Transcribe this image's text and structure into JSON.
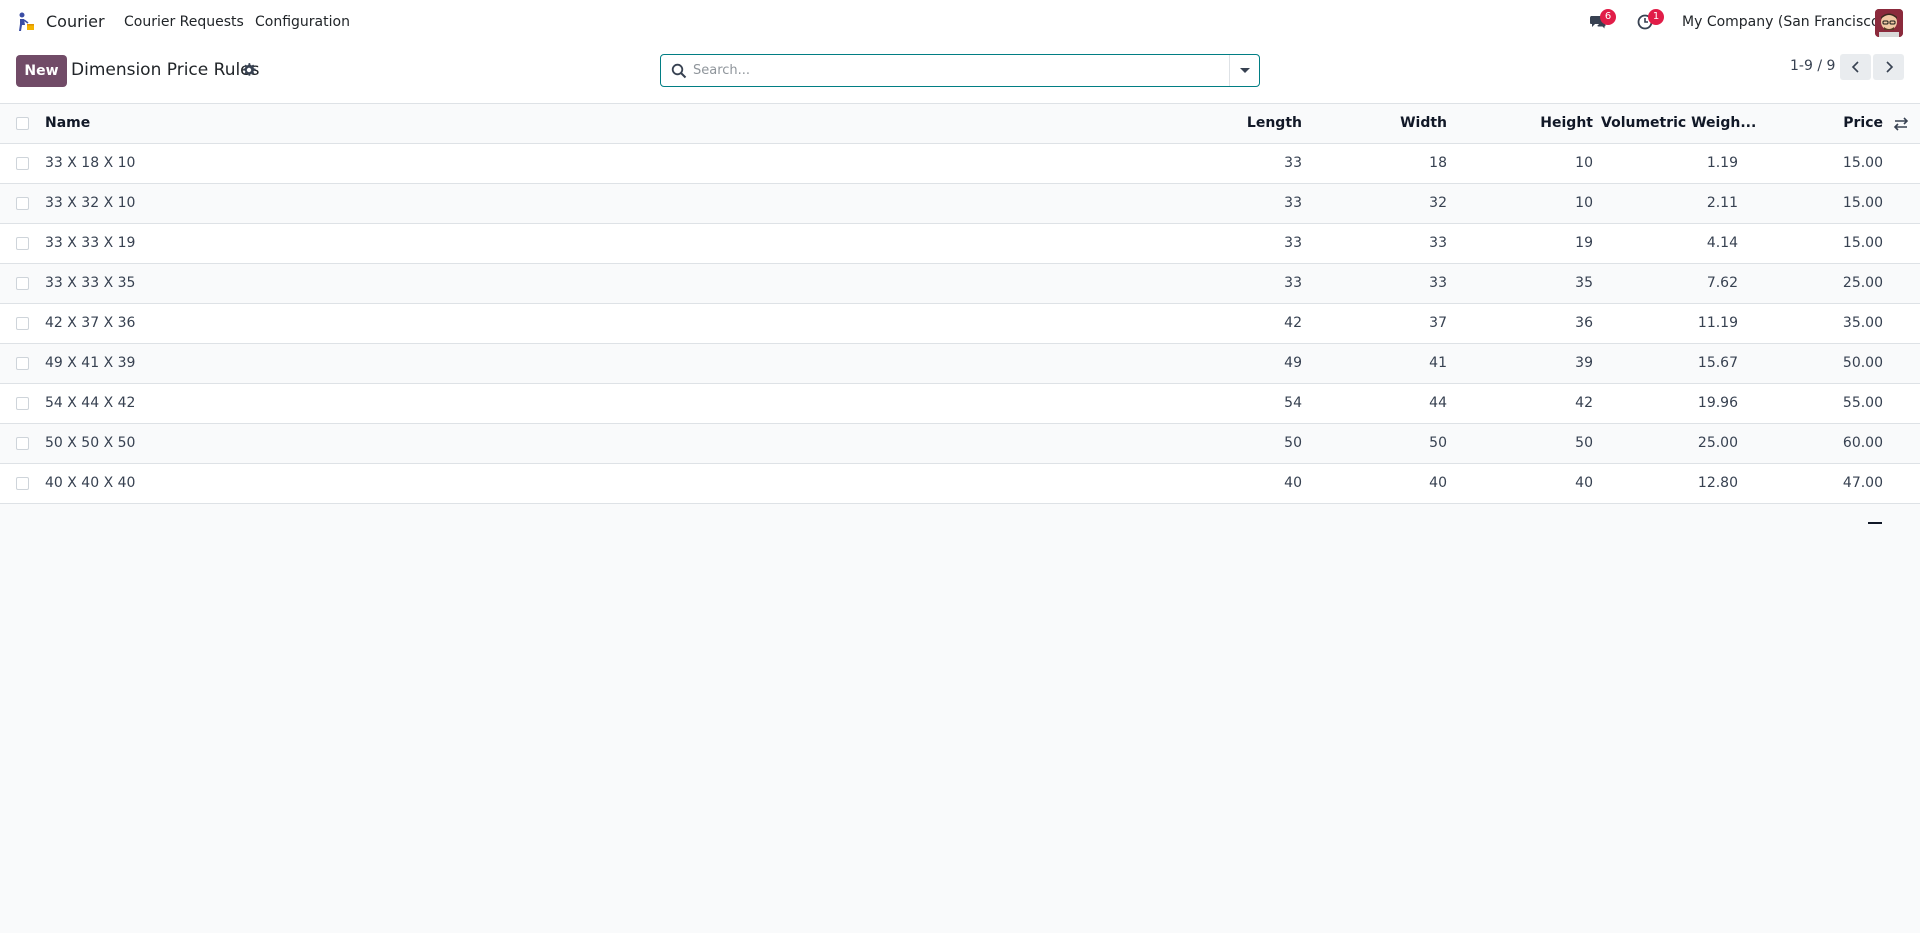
{
  "navbar": {
    "app_name": "Courier",
    "menus": [
      "Courier Requests",
      "Configuration"
    ],
    "messages_count": "6",
    "activities_count": "1",
    "company": "My Company (San Francisco)"
  },
  "control": {
    "new_label": "New",
    "title": "Dimension Price Rules",
    "search_placeholder": "Search...",
    "pager": "1-9 / 9"
  },
  "list": {
    "columns": {
      "name": "Name",
      "length": "Length",
      "width": "Width",
      "height": "Height",
      "volumetric": "Volumetric Weigh...",
      "price": "Price"
    },
    "rows": [
      {
        "name": "33 X 18 X 10",
        "length": "33",
        "width": "18",
        "height": "10",
        "volumetric": "1.19",
        "price": "15.00"
      },
      {
        "name": "33 X 32 X 10",
        "length": "33",
        "width": "32",
        "height": "10",
        "volumetric": "2.11",
        "price": "15.00"
      },
      {
        "name": "33 X 33 X 19",
        "length": "33",
        "width": "33",
        "height": "19",
        "volumetric": "4.14",
        "price": "15.00"
      },
      {
        "name": "33 X 33 X 35",
        "length": "33",
        "width": "33",
        "height": "35",
        "volumetric": "7.62",
        "price": "25.00"
      },
      {
        "name": "42 X 37 X 36",
        "length": "42",
        "width": "37",
        "height": "36",
        "volumetric": "11.19",
        "price": "35.00"
      },
      {
        "name": "49 X 41 X 39",
        "length": "49",
        "width": "41",
        "height": "39",
        "volumetric": "15.67",
        "price": "50.00"
      },
      {
        "name": "54 X 44 X 42",
        "length": "54",
        "width": "44",
        "height": "42",
        "volumetric": "19.96",
        "price": "55.00"
      },
      {
        "name": "50 X 50 X 50",
        "length": "50",
        "width": "50",
        "height": "50",
        "volumetric": "25.00",
        "price": "60.00"
      },
      {
        "name": "40 X 40 X 40",
        "length": "40",
        "width": "40",
        "height": "40",
        "volumetric": "12.80",
        "price": "47.00"
      }
    ]
  },
  "colors": {
    "primary": "#714b67",
    "search_border": "#017e84",
    "badge": "#e11d48"
  }
}
